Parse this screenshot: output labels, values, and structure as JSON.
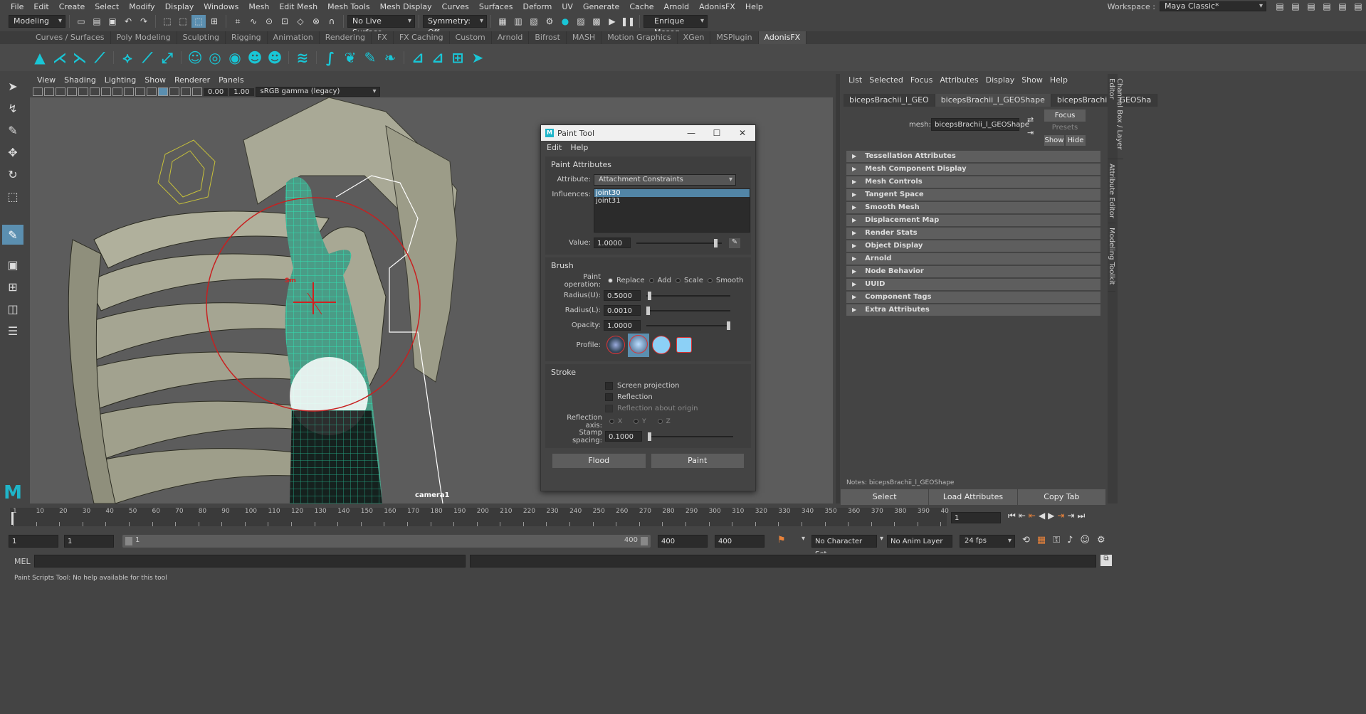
{
  "menubar": {
    "items": [
      "File",
      "Edit",
      "Create",
      "Select",
      "Modify",
      "Display",
      "Windows",
      "Mesh",
      "Edit Mesh",
      "Mesh Tools",
      "Mesh Display",
      "Curves",
      "Surfaces",
      "Deform",
      "UV",
      "Generate",
      "Cache",
      "Arnold",
      "AdonisFX",
      "Help"
    ],
    "workspace_label": "Workspace :",
    "workspace_value": "Maya Classic*"
  },
  "statusline": {
    "mode": "Modeling",
    "live_surface": "No Live Surface",
    "symmetry": "Symmetry: Off",
    "user": "Enrique Meseg..."
  },
  "shelf_tabs": [
    "Curves / Surfaces",
    "Poly Modeling",
    "Sculpting",
    "Rigging",
    "Animation",
    "Rendering",
    "FX",
    "FX Caching",
    "Custom",
    "Arnold",
    "Bifrost",
    "MASH",
    "Motion Graphics",
    "XGen",
    "MSPlugin",
    "AdonisFX"
  ],
  "shelf_active": "AdonisFX",
  "viewport": {
    "menu": [
      "View",
      "Shading",
      "Lighting",
      "Show",
      "Renderer",
      "Panels"
    ],
    "field1": "0.00",
    "field2": "1.00",
    "colorspace": "sRGB gamma (legacy)",
    "camera": "camera1",
    "brush_label": "Sm"
  },
  "paint_tool": {
    "title": "Paint Tool",
    "menu": [
      "Edit",
      "Help"
    ],
    "paint_attributes": "Paint Attributes",
    "attribute_label": "Attribute:",
    "attribute_value": "Attachment Constraints",
    "influences_label": "Influences:",
    "influences": [
      "joint30",
      "joint31"
    ],
    "value_label": "Value:",
    "value": "1.0000",
    "value_level": 0.95,
    "brush": "Brush",
    "paint_op_label": "Paint operation:",
    "paint_ops": [
      "Replace",
      "Add",
      "Scale",
      "Smooth"
    ],
    "radius_u_label": "Radius(U):",
    "radius_u": "0.5000",
    "radius_u_level": 0.02,
    "radius_l_label": "Radius(L):",
    "radius_l": "0.0010",
    "radius_l_level": 0.0,
    "opacity_label": "Opacity:",
    "opacity": "1.0000",
    "opacity_level": 1.0,
    "profile_label": "Profile:",
    "stroke": "Stroke",
    "screen_projection": "Screen projection",
    "reflection": "Reflection",
    "reflection_origin": "Reflection about origin",
    "reflection_axis_label": "Reflection axis:",
    "axes": [
      "X",
      "Y",
      "Z"
    ],
    "stamp_spacing_label": "Stamp spacing:",
    "stamp_spacing": "0.1000",
    "stamp_level": 0.0,
    "flood": "Flood",
    "paint": "Paint"
  },
  "attribute_editor": {
    "menu": [
      "List",
      "Selected",
      "Focus",
      "Attributes",
      "Display",
      "Show",
      "Help"
    ],
    "tabs": [
      "bicepsBrachii_l_GEO",
      "bicepsBrachii_l_GEOShape",
      "bicepsBrachii_l_GEOSha"
    ],
    "mesh_label": "mesh:",
    "mesh_value": "bicepsBrachii_l_GEOShape",
    "focus": "Focus",
    "presets": "Presets",
    "show": "Show",
    "hide": "Hide",
    "frames": [
      "Tessellation Attributes",
      "Mesh Component Display",
      "Mesh Controls",
      "Tangent Space",
      "Smooth Mesh",
      "Displacement Map",
      "Render Stats",
      "Object Display",
      "Arnold",
      "Node Behavior",
      "UUID",
      "Component Tags",
      "Extra Attributes"
    ],
    "notes": "Notes: bicepsBrachii_l_GEOShape",
    "buttons": [
      "Select",
      "Load Attributes",
      "Copy Tab"
    ]
  },
  "vertical_tabs": [
    "Channel Box / Layer Editor",
    "Attribute Editor",
    "Modeling Toolkit"
  ],
  "timeslider": {
    "ticks": [
      "1",
      "10",
      "20",
      "30",
      "40",
      "50",
      "60",
      "70",
      "80",
      "90",
      "100",
      "110",
      "120",
      "130",
      "140",
      "150",
      "160",
      "170",
      "180",
      "190",
      "200",
      "210",
      "220",
      "230",
      "240",
      "250",
      "260",
      "270",
      "280",
      "290",
      "300",
      "310",
      "320",
      "330",
      "340",
      "350",
      "360",
      "370",
      "380",
      "390",
      "40"
    ],
    "current_frame": "1"
  },
  "range": {
    "start": "1",
    "start2": "1",
    "inner_start": "1",
    "inner_end": "400",
    "end": "400",
    "end2": "400",
    "character_set": "No Character Set",
    "anim_layer": "No Anim Layer",
    "fps": "24 fps"
  },
  "cmdline": {
    "label": "MEL"
  },
  "helpline": "Paint Scripts Tool: No help available for this tool"
}
